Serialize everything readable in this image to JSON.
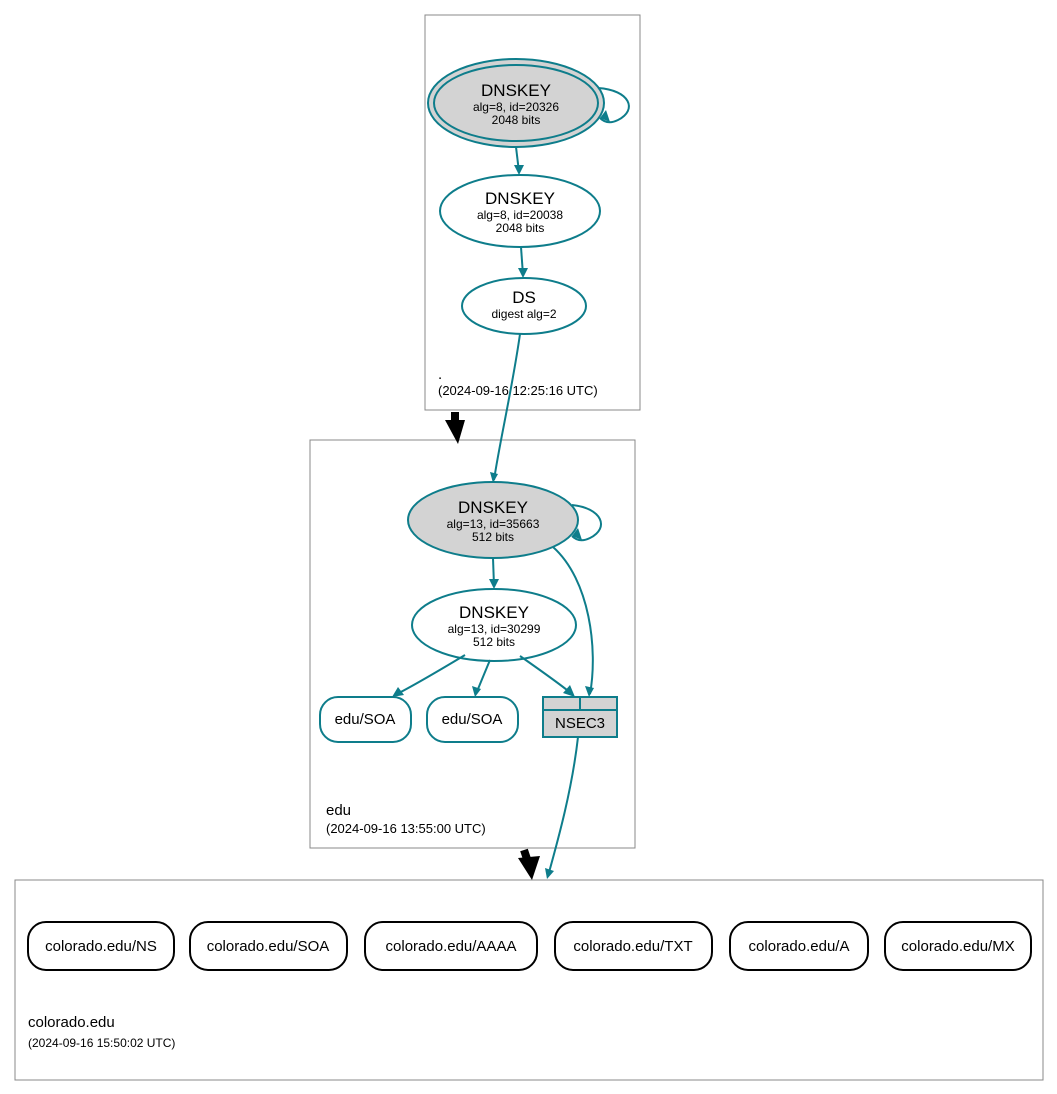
{
  "zones": {
    "root": {
      "name": ".",
      "timestamp": "(2024-09-16 12:25:16 UTC)",
      "dnskey_ksk": {
        "title": "DNSKEY",
        "alg": "alg=8, id=20326",
        "bits": "2048 bits"
      },
      "dnskey_zsk": {
        "title": "DNSKEY",
        "alg": "alg=8, id=20038",
        "bits": "2048 bits"
      },
      "ds": {
        "title": "DS",
        "alg": "digest alg=2"
      }
    },
    "edu": {
      "name": "edu",
      "timestamp": "(2024-09-16 13:55:00 UTC)",
      "dnskey_ksk": {
        "title": "DNSKEY",
        "alg": "alg=13, id=35663",
        "bits": "512 bits"
      },
      "dnskey_zsk": {
        "title": "DNSKEY",
        "alg": "alg=13, id=30299",
        "bits": "512 bits"
      },
      "soa1": "edu/SOA",
      "soa2": "edu/SOA",
      "nsec3": "NSEC3"
    },
    "colorado": {
      "name": "colorado.edu",
      "timestamp": "(2024-09-16 15:50:02 UTC)",
      "records": {
        "ns": "colorado.edu/NS",
        "soa": "colorado.edu/SOA",
        "aaaa": "colorado.edu/AAAA",
        "txt": "colorado.edu/TXT",
        "a": "colorado.edu/A",
        "mx": "colorado.edu/MX"
      }
    }
  }
}
